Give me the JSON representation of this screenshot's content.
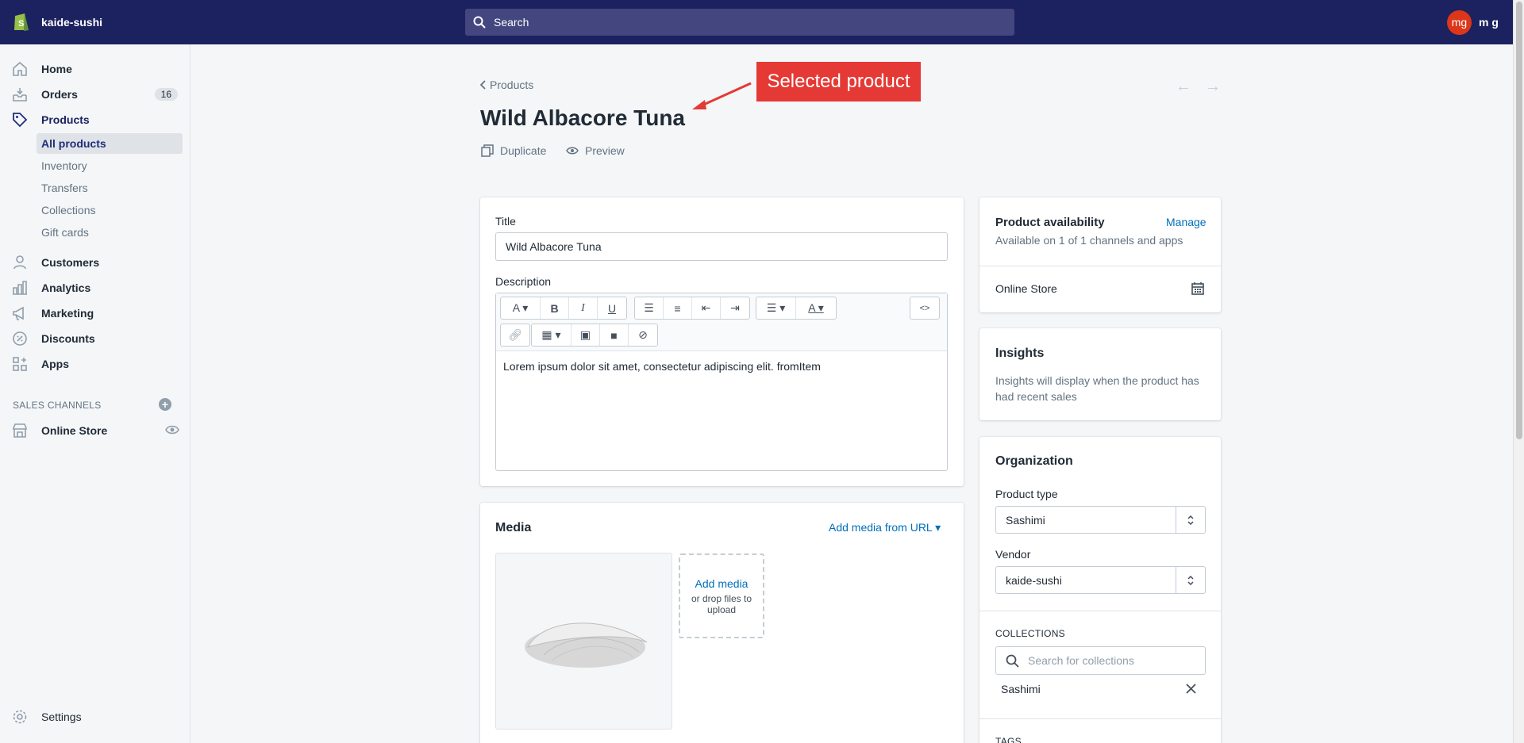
{
  "topbar": {
    "store_name": "kaide-sushi",
    "search_placeholder": "Search",
    "avatar_initials": "mg",
    "user_name": "m g"
  },
  "sidebar": {
    "items": [
      {
        "label": "Home",
        "icon": "home-icon"
      },
      {
        "label": "Orders",
        "icon": "orders-icon",
        "badge": "16"
      },
      {
        "label": "Products",
        "icon": "tag-icon"
      },
      {
        "label": "Customers",
        "icon": "person-icon"
      },
      {
        "label": "Analytics",
        "icon": "bar-chart-icon"
      },
      {
        "label": "Marketing",
        "icon": "megaphone-icon"
      },
      {
        "label": "Discounts",
        "icon": "discount-icon"
      },
      {
        "label": "Apps",
        "icon": "apps-icon"
      }
    ],
    "sub_items": [
      "All products",
      "Inventory",
      "Transfers",
      "Collections",
      "Gift cards"
    ],
    "sales_channels_heading": "SALES CHANNELS",
    "online_store": "Online Store",
    "settings": "Settings"
  },
  "page": {
    "breadcrumb": "Products",
    "title": "Wild Albacore Tuna",
    "duplicate": "Duplicate",
    "preview": "Preview"
  },
  "annotation": "Selected product",
  "details": {
    "title_label": "Title",
    "title_value": "Wild Albacore Tuna",
    "description_label": "Description",
    "description_text": "Lorem ipsum dolor sit amet, consectetur adipiscing elit. fromItem"
  },
  "media": {
    "heading": "Media",
    "add_from_url": "Add media from URL",
    "add_media": "Add media",
    "drop_hint": "or drop files to upload"
  },
  "availability": {
    "heading": "Product availability",
    "manage": "Manage",
    "summary": "Available on 1 of 1 channels and apps",
    "channel": "Online Store"
  },
  "insights": {
    "heading": "Insights",
    "text": "Insights will display when the product has had recent sales"
  },
  "organization": {
    "heading": "Organization",
    "product_type_label": "Product type",
    "product_type_value": "Sashimi",
    "vendor_label": "Vendor",
    "vendor_value": "kaide-sushi",
    "collections_heading": "COLLECTIONS",
    "collections_placeholder": "Search for collections",
    "collection_chip": "Sashimi",
    "tags_heading": "TAGS"
  },
  "colors": {
    "topbar": "#1c2260",
    "link": "#006fbb",
    "annotation": "#e53935"
  }
}
